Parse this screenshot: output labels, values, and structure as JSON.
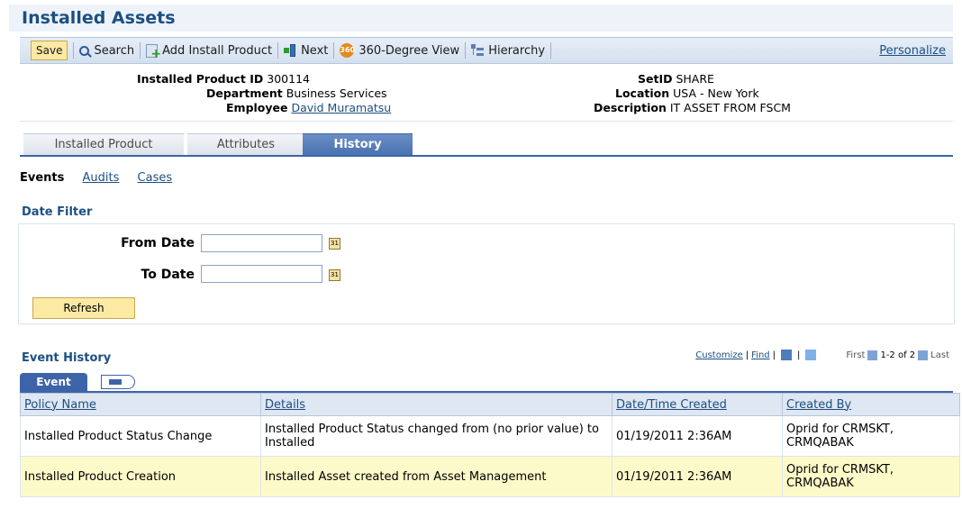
{
  "page": {
    "title": "Installed Assets"
  },
  "toolbar": {
    "save_label": "Save",
    "search_label": "Search",
    "add_install_label": "Add Install Product",
    "next_label": "Next",
    "view360_label": "360-Degree View",
    "hierarchy_label": "Hierarchy",
    "personalize_label": "Personalize",
    "icons": [
      "search-icon",
      "add-product-icon",
      "next-icon",
      "360-icon",
      "hierarchy-icon"
    ]
  },
  "info": {
    "installed_product_id_label": "Installed Product ID",
    "installed_product_id": "300114",
    "department_label": "Department",
    "department": "Business Services",
    "employee_label": "Employee",
    "employee": "David Muramatsu",
    "setid_label": "SetID",
    "setid": "SHARE",
    "location_label": "Location",
    "location": "USA - New York",
    "description_label": "Description",
    "description": "IT ASSET FROM FSCM"
  },
  "tabs": [
    {
      "label": "Installed Product"
    },
    {
      "label": "Attributes"
    },
    {
      "label": "History",
      "active": true
    }
  ],
  "subnav": {
    "events": "Events",
    "audits": "Audits",
    "cases": "Cases"
  },
  "date_filter": {
    "header": "Date Filter",
    "from_label": "From Date",
    "from_value": "",
    "to_label": "To Date",
    "to_value": "",
    "refresh_label": "Refresh"
  },
  "event_history": {
    "header": "Event History",
    "customize": "Customize",
    "find": "Find",
    "first": "First",
    "range": "1-2 of 2",
    "last": "Last",
    "tab_label": "Event",
    "columns": [
      "Policy Name",
      "Details",
      "Date/Time Created",
      "Created By"
    ],
    "rows": [
      {
        "policy": "Installed Product Status Change",
        "details": "Installed Product Status changed from (no prior value) to Installed",
        "datetime": "01/19/2011  2:36AM",
        "created_by": "Oprid for CRMSKT, CRMQABAK"
      },
      {
        "policy": "Installed Product Creation",
        "details": "Installed Asset created from Asset Management",
        "datetime": "01/19/2011  2:36AM",
        "created_by": "Oprid for CRMSKT, CRMQABAK"
      }
    ]
  },
  "colors": {
    "title": "#1c4f82",
    "tab_active": "#3d64a8",
    "highlight_row": "#fdfac9",
    "button": "#fbe9a4"
  }
}
